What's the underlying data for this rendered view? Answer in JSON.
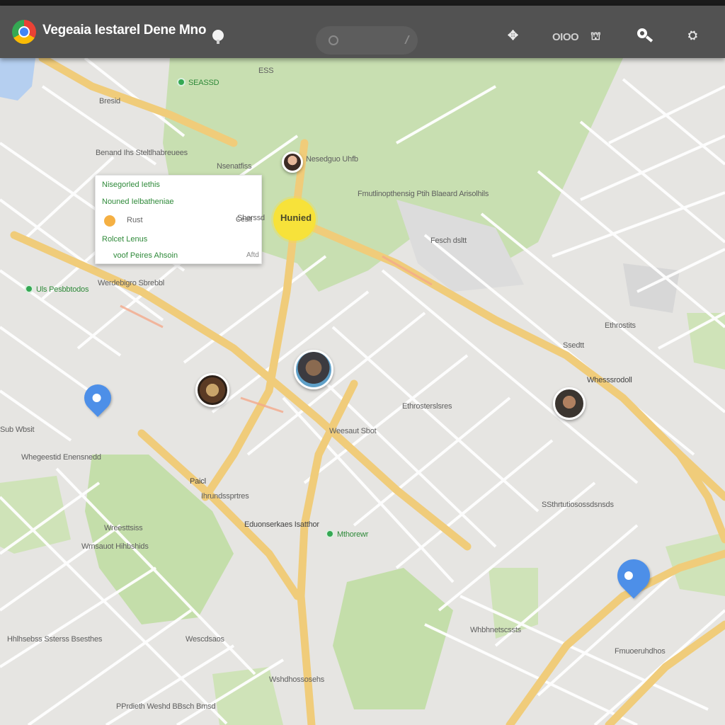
{
  "app": {
    "title": "Vegeaia Iestarel Dene Mno"
  },
  "toolbar": {
    "mode_label": "OIOO"
  },
  "icons": {
    "logo": "map-app-logo-icon",
    "bulb": "lightbulb-icon",
    "search": "search-icon",
    "extension": "puzzle-icon",
    "mode": "transit-icon",
    "user": "account-icon"
  },
  "colors": {
    "toolbar_bg": "#525252",
    "map_bg": "#e6e5e2",
    "park": "#c6dfae",
    "major_road": "#f0cc7a",
    "minor_road": "#ffffff",
    "pin": "#4d8fe8",
    "highlight": "#f7e23a"
  },
  "card": {
    "row1": "Nisegorled Iethis",
    "row2": "Nouned Ielbatheniae",
    "row3": "Rust",
    "row3_right": "Ceslt",
    "row4": "Rolcet Lenus",
    "row5": "voof Peires Ahsoin",
    "row5_right": "Aftd"
  },
  "highlight": {
    "label": "Hunied"
  },
  "labels": {
    "l1": "SEASSD",
    "l2": "ESS",
    "l3": "Bresid",
    "l4": "Benand Ihs Steltlhabreuees",
    "l5": "Nsenatfiss",
    "l6": "Nesedguo Uhfb",
    "l7": "Fmutlinopthensig Ptih Blaeard Arisolhils",
    "l8": "Sherssd",
    "l9": "Fesch dsltt",
    "l10": "Ethrostits",
    "l11": "Ssedtt",
    "l12": "Whesssrodoll",
    "l13": "Ethrosterslsres",
    "l14": "Werdebigro Sbrebbl",
    "l15": "Uls Pesbbtodos",
    "l16": "Weesaut Sbot",
    "l17": "Sub Wbsit",
    "l18": "Whegeestid Enensnedd",
    "l19": "Paicl",
    "l20": "Ihrundssprtres",
    "l21": "SSthrtutiosossdsnsds",
    "l22": "Wreesttsiss",
    "l23": "Wrnsauot Hihbshids",
    "l24": "Eduonserkaes Isatthor",
    "l25": "Mthorewr",
    "l26": "Hhlhsebss Ssterss Bsesthes",
    "l27": "Wescdsaos",
    "l28": "Whbhnetscssts",
    "l29": "Fmuoeruhdhos",
    "l30": "Wshdhossosehs",
    "l31": "PPrdieth Weshd BBsch Bmsd"
  }
}
